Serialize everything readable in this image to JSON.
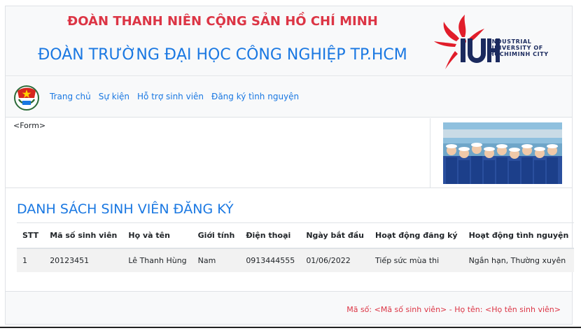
{
  "header": {
    "title_top": "ĐOÀN THANH NIÊN CỘNG SẢN HỒ CHÍ MINH",
    "title_main": "ĐOÀN TRƯỜNG ĐẠI HỌC CÔNG NGHIỆP TP.HCM",
    "logo": {
      "mark": "IUH",
      "lines": [
        "INDUSTRIAL",
        "UNIVERSITY OF",
        "HOCHIMINH CITY"
      ]
    }
  },
  "nav": {
    "links": [
      "Trang chủ",
      "Sự kiện",
      "Hỗ trợ sinh viên",
      "Đăng ký tình nguyện"
    ]
  },
  "content": {
    "form_placeholder": "<Form>"
  },
  "list": {
    "title": "DANH SÁCH SINH VIÊN ĐĂNG KÝ",
    "columns": [
      "STT",
      "Mã số sinh viên",
      "Họ và tên",
      "Giới tính",
      "Điện thoại",
      "Ngày bắt đầu",
      "Hoạt động đăng ký",
      "Hoạt động tình nguyện"
    ],
    "rows": [
      [
        "1",
        "20123451",
        "Lê Thanh Hùng",
        "Nam",
        "0913444555",
        "01/06/2022",
        "Tiếp sức mùa thi",
        "Ngắn hạn, Thường xuyên"
      ]
    ]
  },
  "footer": {
    "text": "Mã số: <Mã số sinh viên> - Họ tên: <Họ tên sinh viên>"
  },
  "colors": {
    "accent_blue": "#1a78e2",
    "accent_red": "#dc3545",
    "panel_bg": "#f8f9fa"
  }
}
